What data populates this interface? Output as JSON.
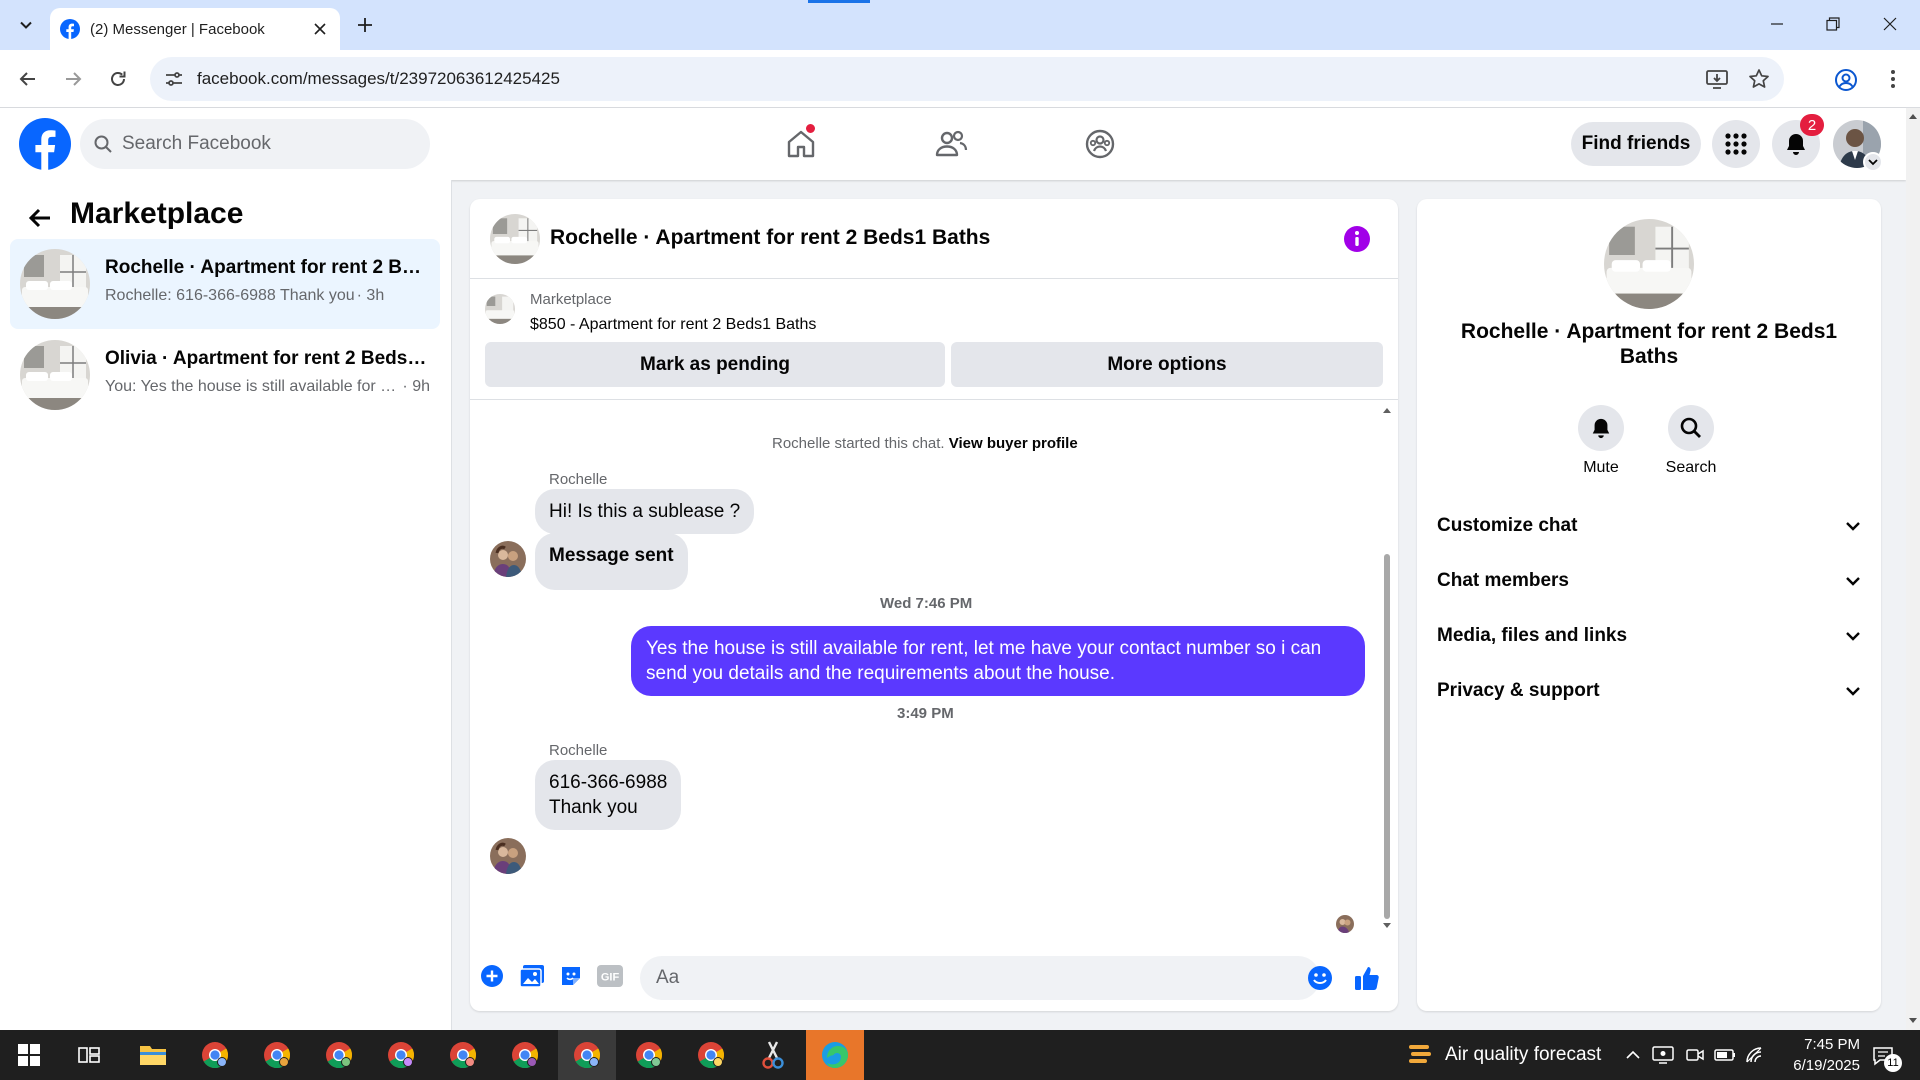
{
  "browser": {
    "tab_title": "(2) Messenger | Facebook",
    "url": "facebook.com/messages/t/23972063612425425"
  },
  "fb": {
    "search_placeholder": "Search Facebook",
    "find_friends": "Find friends",
    "notification_count": "2",
    "home_has_dot": true
  },
  "sidebar": {
    "title": "Marketplace",
    "conversations": [
      {
        "name": "Rochelle · Apartment for rent 2 Beds1 Baths",
        "preview": "Rochelle: 616-366-6988 Thank you",
        "time": "· 3h",
        "active": true
      },
      {
        "name": "Olivia · Apartment for rent 2 Beds1 Baths",
        "preview": "You: Yes the house is still available for rent, let me have your contact number",
        "time": "· 9h",
        "active": false
      }
    ]
  },
  "chat": {
    "title": "Rochelle · Apartment for rent 2 Beds1 Baths",
    "listing_source": "Marketplace",
    "listing_title": "$850 - Apartment for rent 2 Beds1 Baths",
    "mark_pending": "Mark as pending",
    "more_options": "More options",
    "system_text": "Rochelle started this chat.",
    "view_profile": "View buyer profile",
    "sender1": "Rochelle",
    "msg1": "Hi! Is this a sublease ?",
    "msg2": "Message sent",
    "time1": "Wed 7:46 PM",
    "msg3": "Yes the house is still available for rent, let me have your contact number so i can send you details and the requirements about the house.",
    "time2": "3:49 PM",
    "sender2": "Rochelle",
    "msg4_line1": "616-366-6988",
    "msg4_line2": "Thank you",
    "input_placeholder": "Aa"
  },
  "info_panel": {
    "name": "Rochelle · Apartment for rent 2 Beds1 Baths",
    "mute": "Mute",
    "search": "Search",
    "sections": [
      "Customize chat",
      "Chat members",
      "Media, files and links",
      "Privacy & support"
    ]
  },
  "taskbar": {
    "weather_text": "Air quality forecast",
    "time": "7:45 PM",
    "date": "6/19/2025",
    "notification_count": "11"
  },
  "colors": {
    "fb_blue": "#0866ff",
    "outgoing_bubble": "#5b39ff",
    "info_icon": "#a100e8",
    "badge_red": "#e41e3f"
  }
}
